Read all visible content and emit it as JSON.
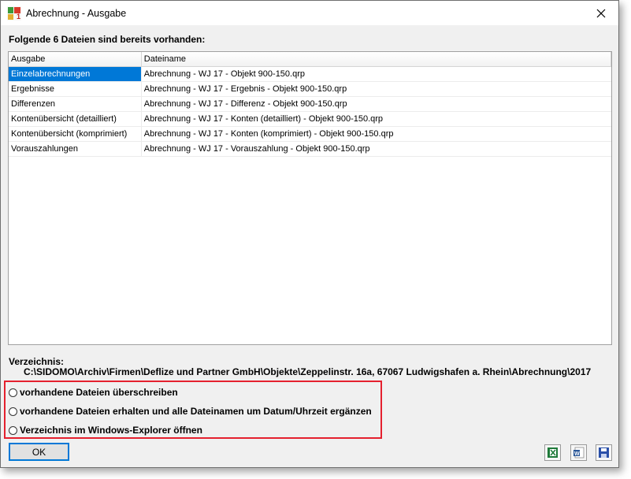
{
  "window": {
    "title": "Abrechnung - Ausgabe"
  },
  "heading": "Folgende 6 Dateien sind bereits vorhanden:",
  "table": {
    "columns": [
      "Ausgabe",
      "Dateiname"
    ],
    "rows": [
      {
        "ausgabe": "Einzelabrechnungen",
        "dateiname": "Abrechnung - WJ 17 - Objekt 900-150.qrp"
      },
      {
        "ausgabe": "Ergebnisse",
        "dateiname": "Abrechnung - WJ 17 - Ergebnis - Objekt 900-150.qrp"
      },
      {
        "ausgabe": "Differenzen",
        "dateiname": "Abrechnung - WJ 17 - Differenz - Objekt 900-150.qrp"
      },
      {
        "ausgabe": "Kontenübersicht (detailliert)",
        "dateiname": "Abrechnung - WJ 17 - Konten (detailliert) - Objekt 900-150.qrp"
      },
      {
        "ausgabe": "Kontenübersicht (komprimiert)",
        "dateiname": "Abrechnung - WJ 17 - Konten (komprimiert) - Objekt 900-150.qrp"
      },
      {
        "ausgabe": "Vorauszahlungen",
        "dateiname": "Abrechnung - WJ 17 - Vorauszahlung - Objekt 900-150.qrp"
      }
    ],
    "selected_index": 0
  },
  "directory": {
    "label": "Verzeichnis:",
    "path": "C:\\SIDOMO\\Archiv\\Firmen\\Deflize und Partner GmbH\\Objekte\\Zeppelinstr. 16a, 67067 Ludwigshafen a. Rhein\\Abrechnung\\2017"
  },
  "options": [
    "vorhandene Dateien überschreiben",
    "vorhandene Dateien erhalten und alle Dateinamen um Datum/Uhrzeit ergänzen",
    "Verzeichnis im Windows-Explorer öffnen"
  ],
  "buttons": {
    "ok": "OK"
  },
  "icons": {
    "app": "app-icon",
    "close": "close-icon",
    "excel": "excel-export-icon",
    "word": "word-export-icon",
    "save": "save-icon"
  },
  "colors": {
    "selection": "#0078d7",
    "highlight_border": "#e5202e"
  }
}
